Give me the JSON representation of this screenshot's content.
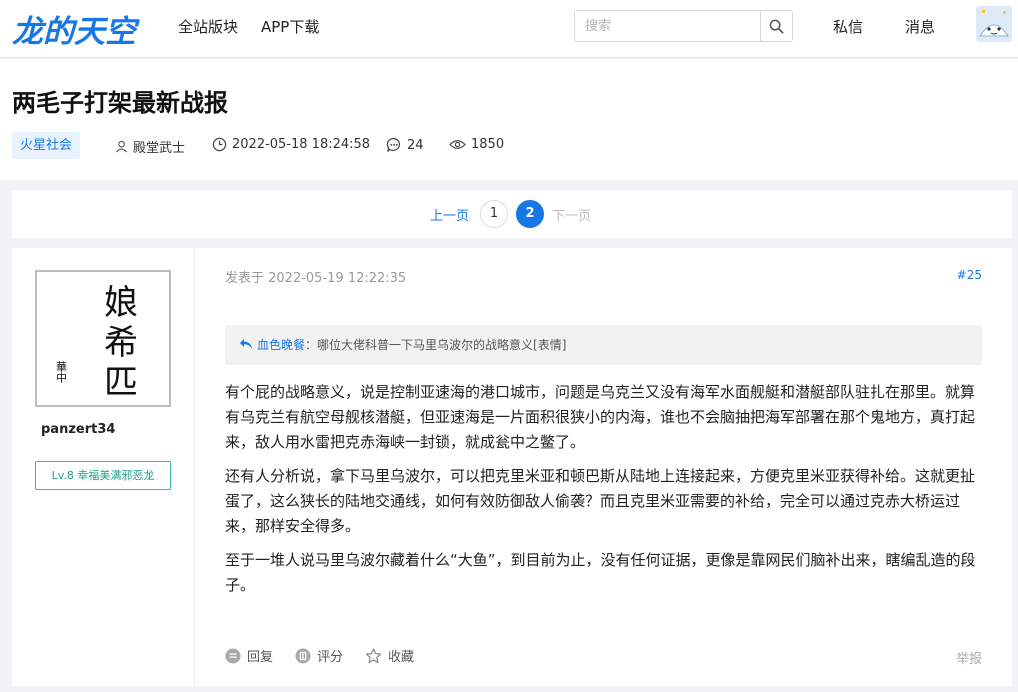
{
  "site": {
    "logo": "龙的天空"
  },
  "nav": {
    "forums": "全站版块",
    "app": "APP下载"
  },
  "search": {
    "placeholder": "搜索"
  },
  "top_actions": {
    "messages": "私信",
    "notifications": "消息"
  },
  "thread": {
    "title": "两毛子打架最新战报",
    "forum": "火星社会",
    "author": "殿堂武士",
    "datetime": "2022-05-18 18:24:58",
    "replies": "24",
    "views": "1850"
  },
  "pagination": {
    "prev": "上一页",
    "pages": [
      "1",
      "2"
    ],
    "current": "2",
    "next": "下一页"
  },
  "post": {
    "username": "panzert34",
    "level": "Lv.8 幸福美满邪恶龙",
    "avatar_chars": [
      "娘",
      "希",
      "匹"
    ],
    "avatar_seal": "華中",
    "posted_at": "发表于 2022-05-19 12:22:35",
    "floor": "#25",
    "quote_user": "血色晚餐",
    "quote_text": "：哪位大佬科普一下马里乌波尔的战略意义[表情]",
    "paragraphs": [
      "有个屁的战略意义，说是控制亚速海的港口城市，问题是乌克兰又没有海军水面舰艇和潜艇部队驻扎在那里。就算有乌克兰有航空母舰核潜艇，但亚速海是一片面积很狭小的内海，谁也不会脑抽把海军部署在那个鬼地方，真打起来，敌人用水雷把克赤海峡一封锁，就成瓮中之鳖了。",
      "还有人分析说，拿下马里乌波尔，可以把克里米亚和顿巴斯从陆地上连接起来，方便克里米亚获得补给。这就更扯蛋了，这么狭长的陆地交通线，如何有效防御敌人偷袭？而且克里米亚需要的补给，完全可以通过克赤大桥运过来，那样安全得多。",
      "至于一堆人说马里乌波尔藏着什么“大鱼”，到目前为止，没有任何证据，更像是靠网民们脑补出来，瞎编乱造的段子。"
    ],
    "actions": {
      "reply": "回复",
      "rate": "评分",
      "favorite": "收藏"
    },
    "report": "举报"
  },
  "colors": {
    "accent": "#1677e5",
    "level": "#1fa08c",
    "background": "#f1f2f5"
  }
}
